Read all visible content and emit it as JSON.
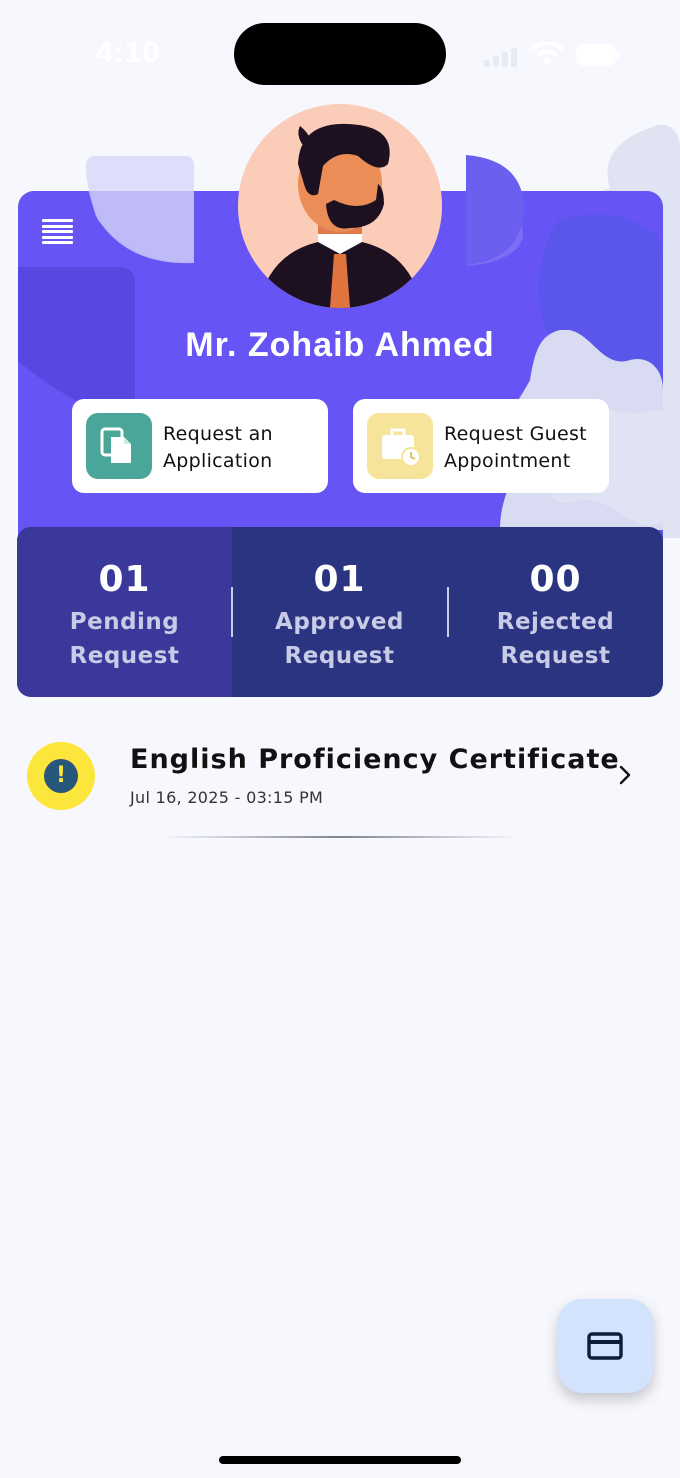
{
  "status_bar": {
    "time": "4:10"
  },
  "profile": {
    "name": "Mr. Zohaib Ahmed",
    "avatar_icon": "man-avatar"
  },
  "actions": [
    {
      "label_line1": "Request an",
      "label_line2": "Application",
      "icon": "documents-icon",
      "color": "#4aa698"
    },
    {
      "label_line1": "Request Guest",
      "label_line2": "Appointment",
      "icon": "briefcase-clock-icon",
      "color": "#f6e49a"
    }
  ],
  "stats": [
    {
      "count": "01",
      "label_line1": "Pending",
      "label_line2": "Request",
      "active": true
    },
    {
      "count": "01",
      "label_line1": "Approved",
      "label_line2": "Request",
      "active": false
    },
    {
      "count": "00",
      "label_line1": "Rejected",
      "label_line2": "Request",
      "active": false
    }
  ],
  "requests": [
    {
      "title": "English Proficiency Certificate",
      "datetime": "Jul 16, 2025 - 03:15 PM",
      "status_icon": "exclamation-icon",
      "status_color": "#fde63c"
    }
  ],
  "fab": {
    "icon": "credit-card-icon"
  },
  "colors": {
    "primary": "#6654f4",
    "stats_bg": "#2a3480",
    "background": "#f7f8fe"
  }
}
